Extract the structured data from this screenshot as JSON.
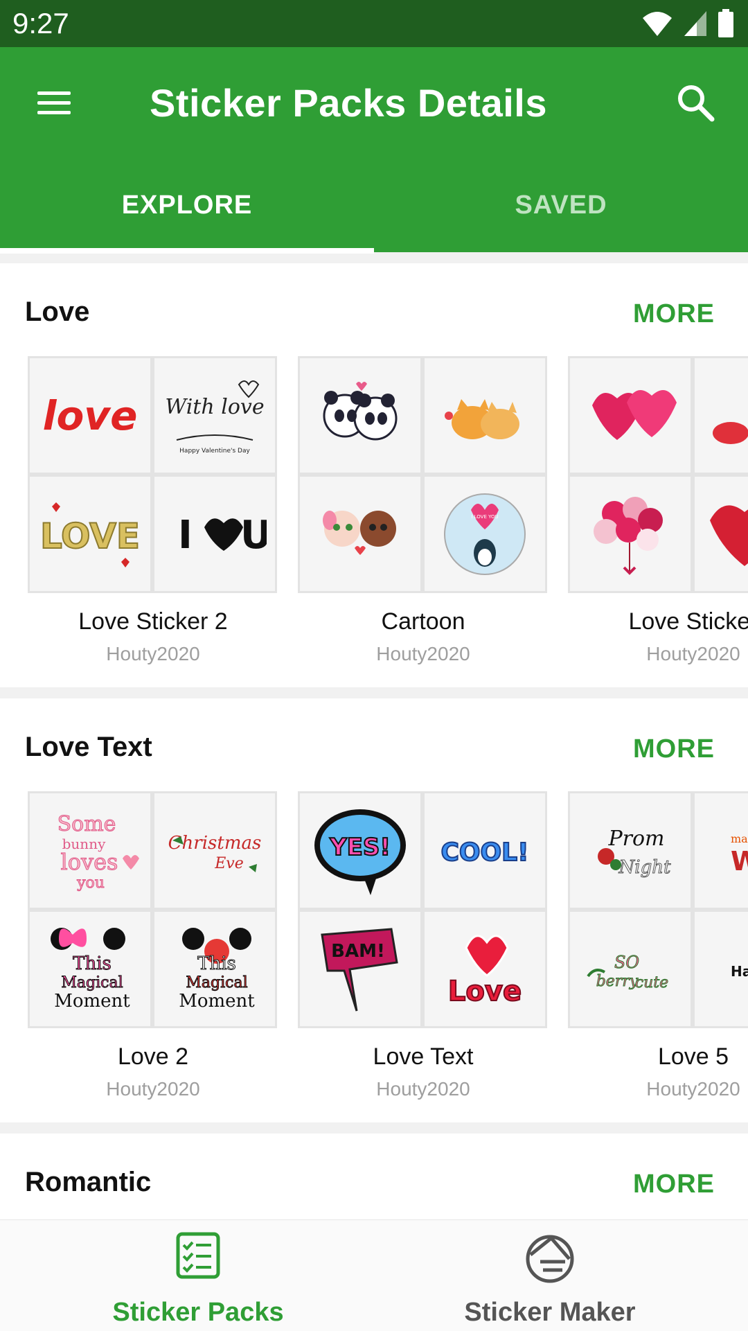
{
  "status_bar": {
    "time": "9:27"
  },
  "app_bar": {
    "title": "Sticker Packs Details"
  },
  "tabs": [
    {
      "label": "EXPLORE",
      "active": true
    },
    {
      "label": "SAVED",
      "active": false
    }
  ],
  "sections": [
    {
      "title": "Love",
      "more_label": "MORE",
      "packs": [
        {
          "name": "Love Sticker 2",
          "author": "Houty2020",
          "stickers": [
            "love-glitter-sticker",
            "with-love-valentine-sticker",
            "love-3d-sticker",
            "i-heart-u-sticker"
          ],
          "sticker_text": [
            "love",
            "With love",
            "Happy Valentine's Day",
            "LOVE",
            "I",
            "U"
          ]
        },
        {
          "name": "Cartoon",
          "author": "Houty2020",
          "stickers": [
            "panda-couple-sticker",
            "cat-couple-sticker",
            "puppy-couple-sticker",
            "penguin-love-sticker"
          ],
          "sticker_text": [
            "I LOVE YOU"
          ]
        },
        {
          "name": "Love Sticker",
          "author": "Houty2020",
          "stickers": [
            "two-hearts-sticker",
            "mouse-sticker",
            "heart-balloons-sticker",
            "ornate-heart-sticker"
          ]
        }
      ]
    },
    {
      "title": "Love Text",
      "more_label": "MORE",
      "packs": [
        {
          "name": "Love 2",
          "author": "Houty2020",
          "stickers": [
            "some-bunny-loves-you-sticker",
            "christmas-eve-sticker",
            "magical-moment-pink-sticker",
            "magical-moment-red-sticker"
          ],
          "sticker_text": [
            "Some",
            "bunny",
            "loves",
            "you",
            "Christmas",
            "Eve",
            "This",
            "Magical",
            "Moment",
            "This",
            "Magical",
            "Moment"
          ]
        },
        {
          "name": "Love Text",
          "author": "Houty2020",
          "stickers": [
            "yes-bubble-sticker",
            "cool-sticker",
            "bam-sticker",
            "love-heart-text-sticker"
          ],
          "sticker_text": [
            "YES!",
            "COOL!",
            "BAM!",
            "Love"
          ]
        },
        {
          "name": "Love 5",
          "author": "Houty2020",
          "stickers": [
            "prom-night-sticker",
            "make-a-wish-sticker",
            "so-berry-cute-sticker",
            "having-fun-sticker"
          ],
          "sticker_text": [
            "Prom",
            "Night",
            "make",
            "W",
            "SO",
            "berry",
            "cute",
            "Havin"
          ]
        }
      ]
    },
    {
      "title": "Romantic",
      "more_label": "MORE",
      "packs": []
    }
  ],
  "bottom_nav": [
    {
      "label": "Sticker Packs",
      "icon": "checklist-icon",
      "active": true
    },
    {
      "label": "Sticker Maker",
      "icon": "sticker-maker-icon",
      "active": false
    }
  ],
  "colors": {
    "primary": "#2f9e35",
    "status_bar": "#1f5e1f",
    "inactive_tab": "#bfe3c1",
    "author": "#9e9e9e"
  }
}
